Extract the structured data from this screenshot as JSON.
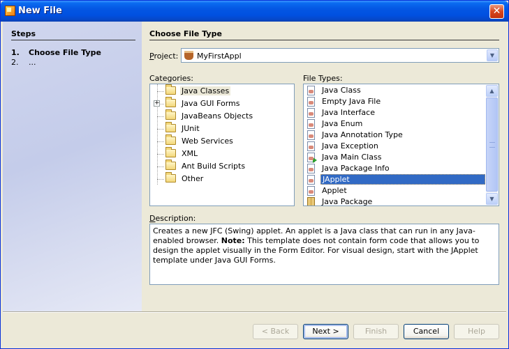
{
  "window": {
    "title": "New File",
    "close_label": "✕"
  },
  "steps": {
    "header": "Steps",
    "items": [
      {
        "number": "1.",
        "label": "Choose File Type"
      },
      {
        "number": "2.",
        "label": "..."
      }
    ]
  },
  "main": {
    "section_title": "Choose File Type",
    "project": {
      "label_prefix": "P",
      "label_rest": "roject:",
      "value": "MyFirstAppl"
    },
    "categories": {
      "label": "Categories:",
      "items": [
        {
          "label": "Java Classes",
          "selected": true
        },
        {
          "label": "Java GUI Forms",
          "expander": "+"
        },
        {
          "label": "JavaBeans Objects"
        },
        {
          "label": "JUnit"
        },
        {
          "label": "Web Services"
        },
        {
          "label": "XML"
        },
        {
          "label": "Ant Build Scripts"
        },
        {
          "label": "Other"
        }
      ]
    },
    "file_types": {
      "label": "File Types:",
      "items": [
        {
          "label": "Java Class"
        },
        {
          "label": "Empty Java File"
        },
        {
          "label": "Java Interface"
        },
        {
          "label": "Java Enum"
        },
        {
          "label": "Java Annotation Type"
        },
        {
          "label": "Java Exception"
        },
        {
          "label": "Java Main Class"
        },
        {
          "label": "Java Package Info"
        },
        {
          "label": "JApplet",
          "selected": true
        },
        {
          "label": "Applet"
        },
        {
          "label": "Java Package"
        }
      ]
    },
    "description": {
      "label_prefix": "D",
      "label_rest": "escription:",
      "text_1": "Creates a new JFC (Swing) applet. An applet is a Java class that can run in any Java-enabled browser. ",
      "note_label": "Note:",
      "text_2": " This template does not contain form code that allows you to design the applet visually in the Form Editor. For visual design, start with the JApplet template under Java GUI Forms."
    }
  },
  "buttons": {
    "back": {
      "label": "< Back",
      "enabled": false
    },
    "next": {
      "label": "Next >",
      "enabled": true
    },
    "finish": {
      "label": "Finish",
      "enabled": false
    },
    "cancel": {
      "label": "Cancel",
      "enabled": true
    },
    "help": {
      "label": "Help",
      "enabled": false
    }
  }
}
